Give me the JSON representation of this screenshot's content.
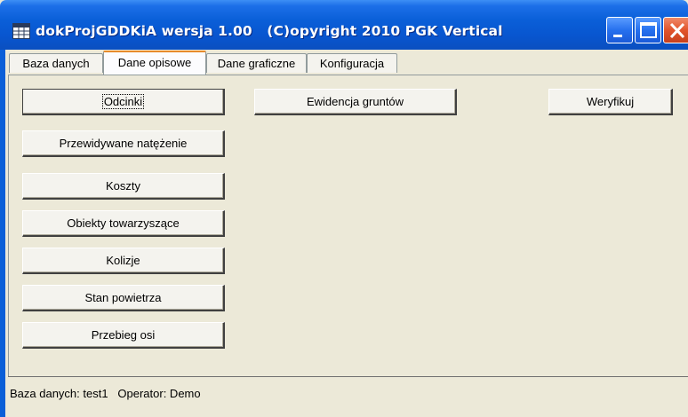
{
  "window": {
    "title": "dokProjGDDKiA wersja 1.00   (C)opyright 2010 PGK Vertical"
  },
  "tabs": [
    {
      "label": "Baza danych",
      "active": false
    },
    {
      "label": "Dane opisowe",
      "active": true
    },
    {
      "label": "Dane graficzne",
      "active": false
    },
    {
      "label": "Konfiguracja",
      "active": false
    }
  ],
  "buttons": {
    "odcinki": "Odcinki",
    "natezenie": "Przewidywane natężenie",
    "koszty": "Koszty",
    "obiekty": "Obiekty towarzyszące",
    "kolizje": "Kolizje",
    "stan_powietrza": "Stan powietrza",
    "przebieg_osi": "Przebieg osi",
    "ewidencja": "Ewidencja gruntów",
    "weryfikuj": "Weryfikuj"
  },
  "status": {
    "text": "Baza danych: test1   Operator: Demo"
  },
  "colors": {
    "titlebar": "#0a5fd8",
    "close_button": "#e2542c",
    "active_tab_accent": "#e68b2c",
    "window_bg": "#ece9d8"
  },
  "icons": {
    "app": "grid-window-icon",
    "minimize": "minimize-icon",
    "maximize": "maximize-icon",
    "close": "close-icon"
  }
}
